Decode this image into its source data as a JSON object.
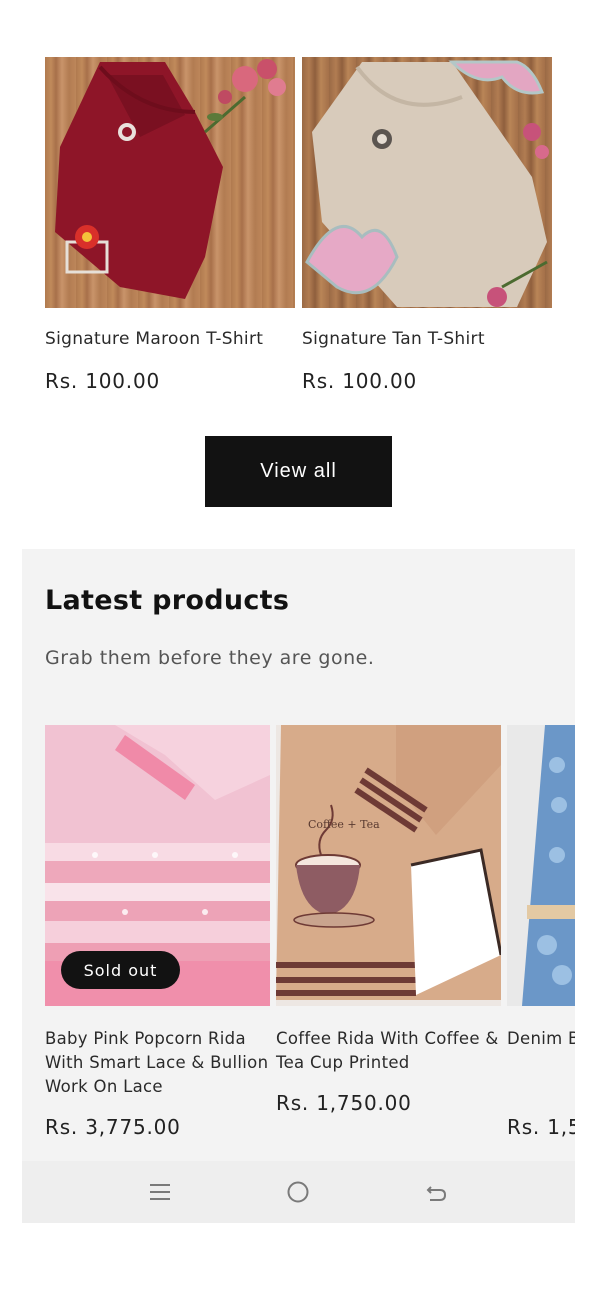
{
  "featured": {
    "products": [
      {
        "title": "Signature Maroon T-Shirt",
        "price": "Rs. 100.00",
        "image": "maroon-tshirt"
      },
      {
        "title": "Signature Tan T-Shirt",
        "price": "Rs. 100.00",
        "image": "tan-tshirt"
      }
    ],
    "view_all_label": "View all"
  },
  "latest": {
    "heading": "Latest products",
    "subheading": "Grab them before they are gone.",
    "products": [
      {
        "title": "Baby Pink Popcorn Rida With Smart Lace & Bullion Work On Lace",
        "price": "Rs. 3,775.00",
        "badge": "Sold out"
      },
      {
        "title": "Coffee Rida With Coffee & Tea Cup Printed",
        "price": "Rs. 1,750.00",
        "print_text": "Coffee + Tea"
      },
      {
        "title": "Denim B With Sm & Lace",
        "price": "Rs. 1,5"
      }
    ]
  },
  "system_nav": {
    "icons": [
      "menu-icon",
      "home-icon",
      "back-icon"
    ]
  },
  "colors": {
    "button_bg": "#121212",
    "section_bg": "#f3f3f3",
    "maroon": "#8e1528",
    "tan": "#d8cbbb"
  }
}
